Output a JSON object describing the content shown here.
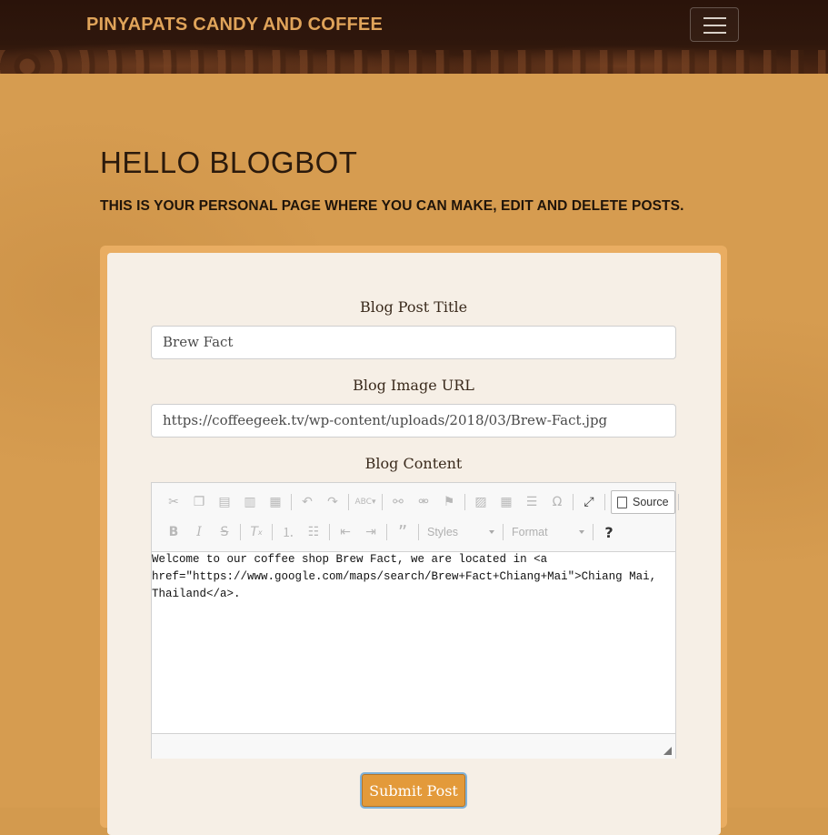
{
  "navbar": {
    "brand": "PINYAPATS CANDY AND COFFEE",
    "toggler_icon": "hamburger-menu-icon"
  },
  "header": {
    "greeting": "HELLO BLOGBOT",
    "subtitle": "THIS IS YOUR PERSONAL PAGE WHERE YOU CAN MAKE, EDIT AND DELETE POSTS."
  },
  "form": {
    "title_label": "Blog Post Title",
    "title_value": "Brew Fact",
    "image_label": "Blog Image URL",
    "image_value": "https://coffeegeek.tv/wp-content/uploads/2018/03/Brew-Fact.jpg",
    "content_label": "Blog Content",
    "content_value": "Welcome to our coffee shop Brew Fact, we are located in <a href=\"https://www.google.com/maps/search/Brew+Fact+Chiang+Mai\">Chiang Mai, Thailand</a>.",
    "submit_label": "Submit Post"
  },
  "editor": {
    "source_label": "Source",
    "styles_label": "Styles",
    "format_label": "Format",
    "help_label": "?"
  },
  "colors": {
    "background": "#d69c50",
    "brand": "#e0a45a",
    "card": "#f6efe6",
    "submit": "#e39a3a"
  }
}
